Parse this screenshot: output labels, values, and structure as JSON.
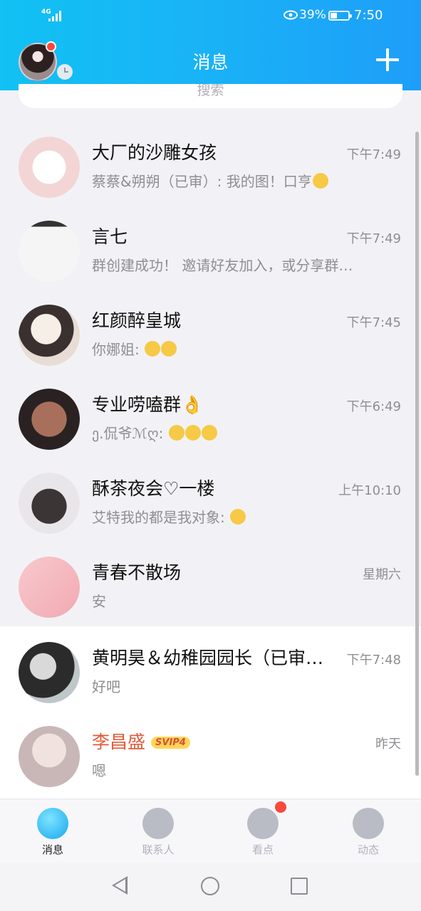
{
  "status_bar": {
    "network": "4G",
    "battery_percent": "39%",
    "battery_level": 0.39,
    "time": "7:50"
  },
  "header": {
    "title": "消息",
    "add_icon": "plus-icon"
  },
  "search": {
    "placeholder": "搜索"
  },
  "conversations": [
    {
      "name": "大厂的沙雕女孩",
      "time": "下午7:49",
      "preview": "蔡蔡&朔朔（已审）: 我的图！口亨",
      "emoji": "pensive-emoji"
    },
    {
      "name": "言七",
      "time": "下午7:49",
      "preview": "群创建成功！ 邀请好友加入，或分享群…",
      "emoji": ""
    },
    {
      "name": "红颜醉皇城",
      "time": "下午7:45",
      "preview": "你娜姐: ",
      "emoji": "crying-emoji"
    },
    {
      "name": "专业唠嗑群👌",
      "time": "下午6:49",
      "preview": "ე.侃爷ℳღ: ",
      "emoji": "crying-emoji"
    },
    {
      "name": "酥茶夜会♡一楼",
      "time": "上午10:10",
      "preview": "艾特我的都是我对象: ",
      "emoji": "smile-emoji"
    },
    {
      "name": "青春不散场",
      "time": "星期六",
      "preview": "安",
      "emoji": ""
    },
    {
      "name": "黄明昊＆幼稚园园长（已审…",
      "time": "下午7:48",
      "preview": "好吧",
      "emoji": ""
    },
    {
      "name": "李昌盛",
      "time": "昨天",
      "preview": "嗯",
      "emoji": "",
      "badge": "SVIP4"
    }
  ],
  "tabs": [
    {
      "label": "消息",
      "icon": "chat-icon",
      "active": true
    },
    {
      "label": "联系人",
      "icon": "contacts-icon",
      "active": false
    },
    {
      "label": "看点",
      "icon": "eye-icon",
      "active": false
    },
    {
      "label": "动态",
      "icon": "star-planet-icon",
      "active": false
    }
  ],
  "colors": {
    "header_start": "#11c1f3",
    "header_end": "#1e9ef9",
    "badge_red": "#f84a3c",
    "vip_name": "#e25b3a"
  }
}
